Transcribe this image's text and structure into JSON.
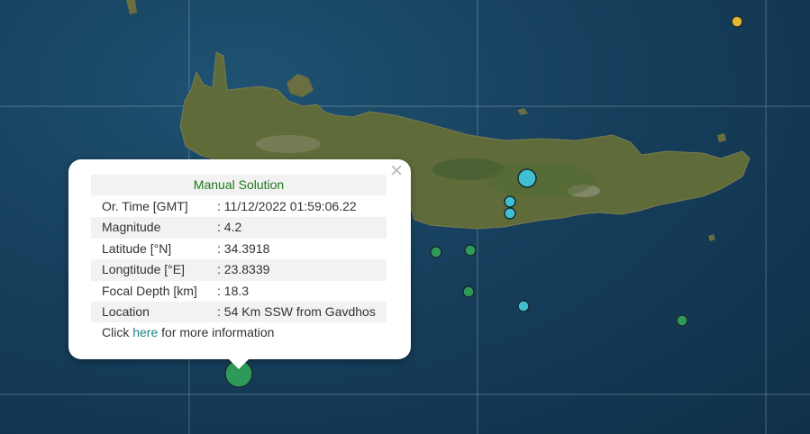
{
  "map": {
    "colors": {
      "sea": "#163f5c",
      "land": "#5f6c3a",
      "quake_green": "#2e9a5a",
      "quake_cyan": "#3fc1d1",
      "quake_yellow": "#e3b62f"
    }
  },
  "markers": [
    {
      "name": "quake-yellow-ne",
      "color": "yellow"
    },
    {
      "name": "quake-cyan-large",
      "color": "cyan"
    },
    {
      "name": "quake-cyan-1",
      "color": "cyan"
    },
    {
      "name": "quake-cyan-2",
      "color": "cyan"
    },
    {
      "name": "quake-green-1",
      "color": "green"
    },
    {
      "name": "quake-green-2",
      "color": "green"
    },
    {
      "name": "quake-green-3",
      "color": "green"
    },
    {
      "name": "quake-cyan-3",
      "color": "cyan"
    },
    {
      "name": "quake-green-4",
      "color": "green"
    },
    {
      "name": "quake-selected",
      "color": "green"
    }
  ],
  "popup": {
    "title": "Manual Solution",
    "close_icon": "close-icon",
    "rows": [
      {
        "label": "Or. Time [GMT]",
        "value": ": 11/12/2022 01:59:06.22"
      },
      {
        "label": "Magnitude",
        "value": ": 4.2"
      },
      {
        "label": "Latitude [°N]",
        "value": ": 34.3918"
      },
      {
        "label": "Longtitude [°E]",
        "value": ": 23.8339"
      },
      {
        "label": "Focal Depth [km]",
        "value": ": 18.3"
      },
      {
        "label": "Location",
        "value": ": 54 Km SSW from Gavdhos"
      }
    ],
    "info_prefix": "Click ",
    "info_link": "here",
    "info_suffix": " for more information"
  }
}
